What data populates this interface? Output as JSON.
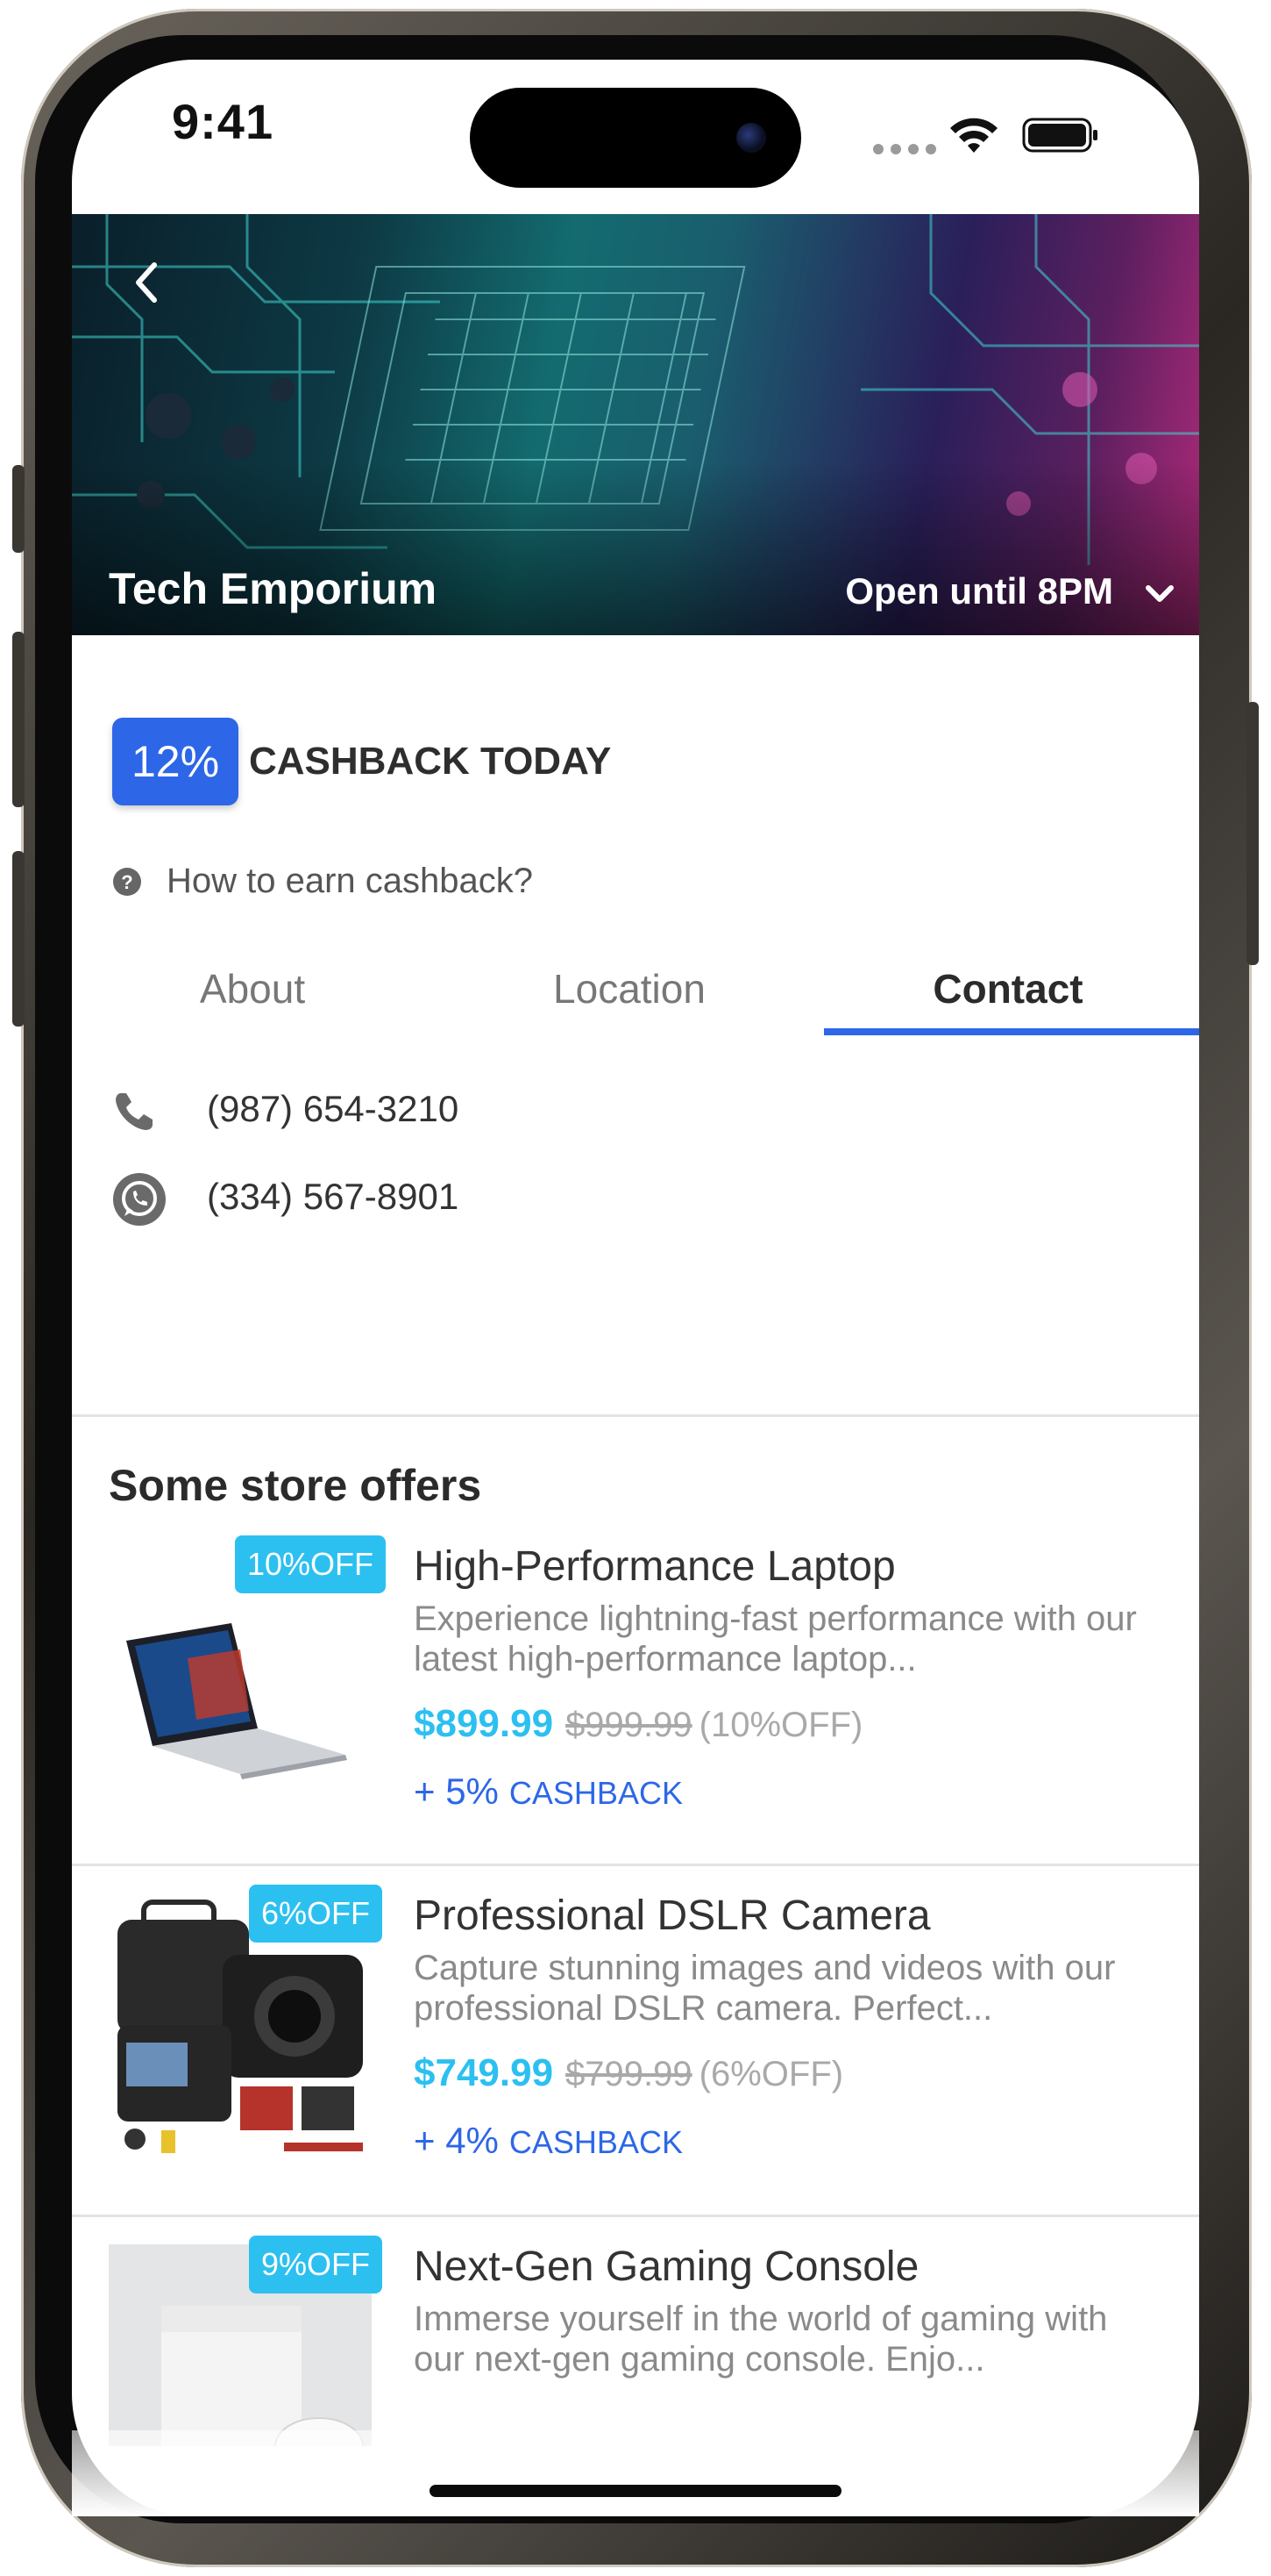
{
  "status_bar": {
    "time": "9:41"
  },
  "header": {
    "store_name": "Tech Emporium",
    "open_hours": "Open until 8PM"
  },
  "cashback": {
    "percent": "12%",
    "label": "CASHBACK TODAY",
    "help_link": "How to earn cashback?"
  },
  "tabs": [
    {
      "label": "About",
      "active": false
    },
    {
      "label": "Location",
      "active": false
    },
    {
      "label": "Contact",
      "active": true
    }
  ],
  "contact": {
    "phone": "(987) 654-3210",
    "whatsapp": "(334) 567-8901"
  },
  "offers_section": {
    "title": "Some store offers",
    "items": [
      {
        "badge": "10%OFF",
        "title": "High-Performance Laptop",
        "description": "Experience lightning-fast performance with our latest high-performance laptop...",
        "price": "$899.99",
        "old_price": "$999.99",
        "discount": "(10%OFF)",
        "cashback_percent": "+ 5%",
        "cashback_label": "CASHBACK"
      },
      {
        "badge": "6%OFF",
        "title": "Professional DSLR Camera",
        "description": "Capture stunning images and videos with our professional DSLR camera. Perfect...",
        "price": "$749.99",
        "old_price": "$799.99",
        "discount": "(6%OFF)",
        "cashback_percent": "+ 4%",
        "cashback_label": "CASHBACK"
      },
      {
        "badge": "9%OFF",
        "title": "Next-Gen Gaming Console",
        "description": "Immerse yourself in the world of gaming with our next-gen gaming console. Enjo..."
      }
    ]
  },
  "colors": {
    "accent_blue": "#2d67e8",
    "price_cyan": "#2cc0f0"
  }
}
